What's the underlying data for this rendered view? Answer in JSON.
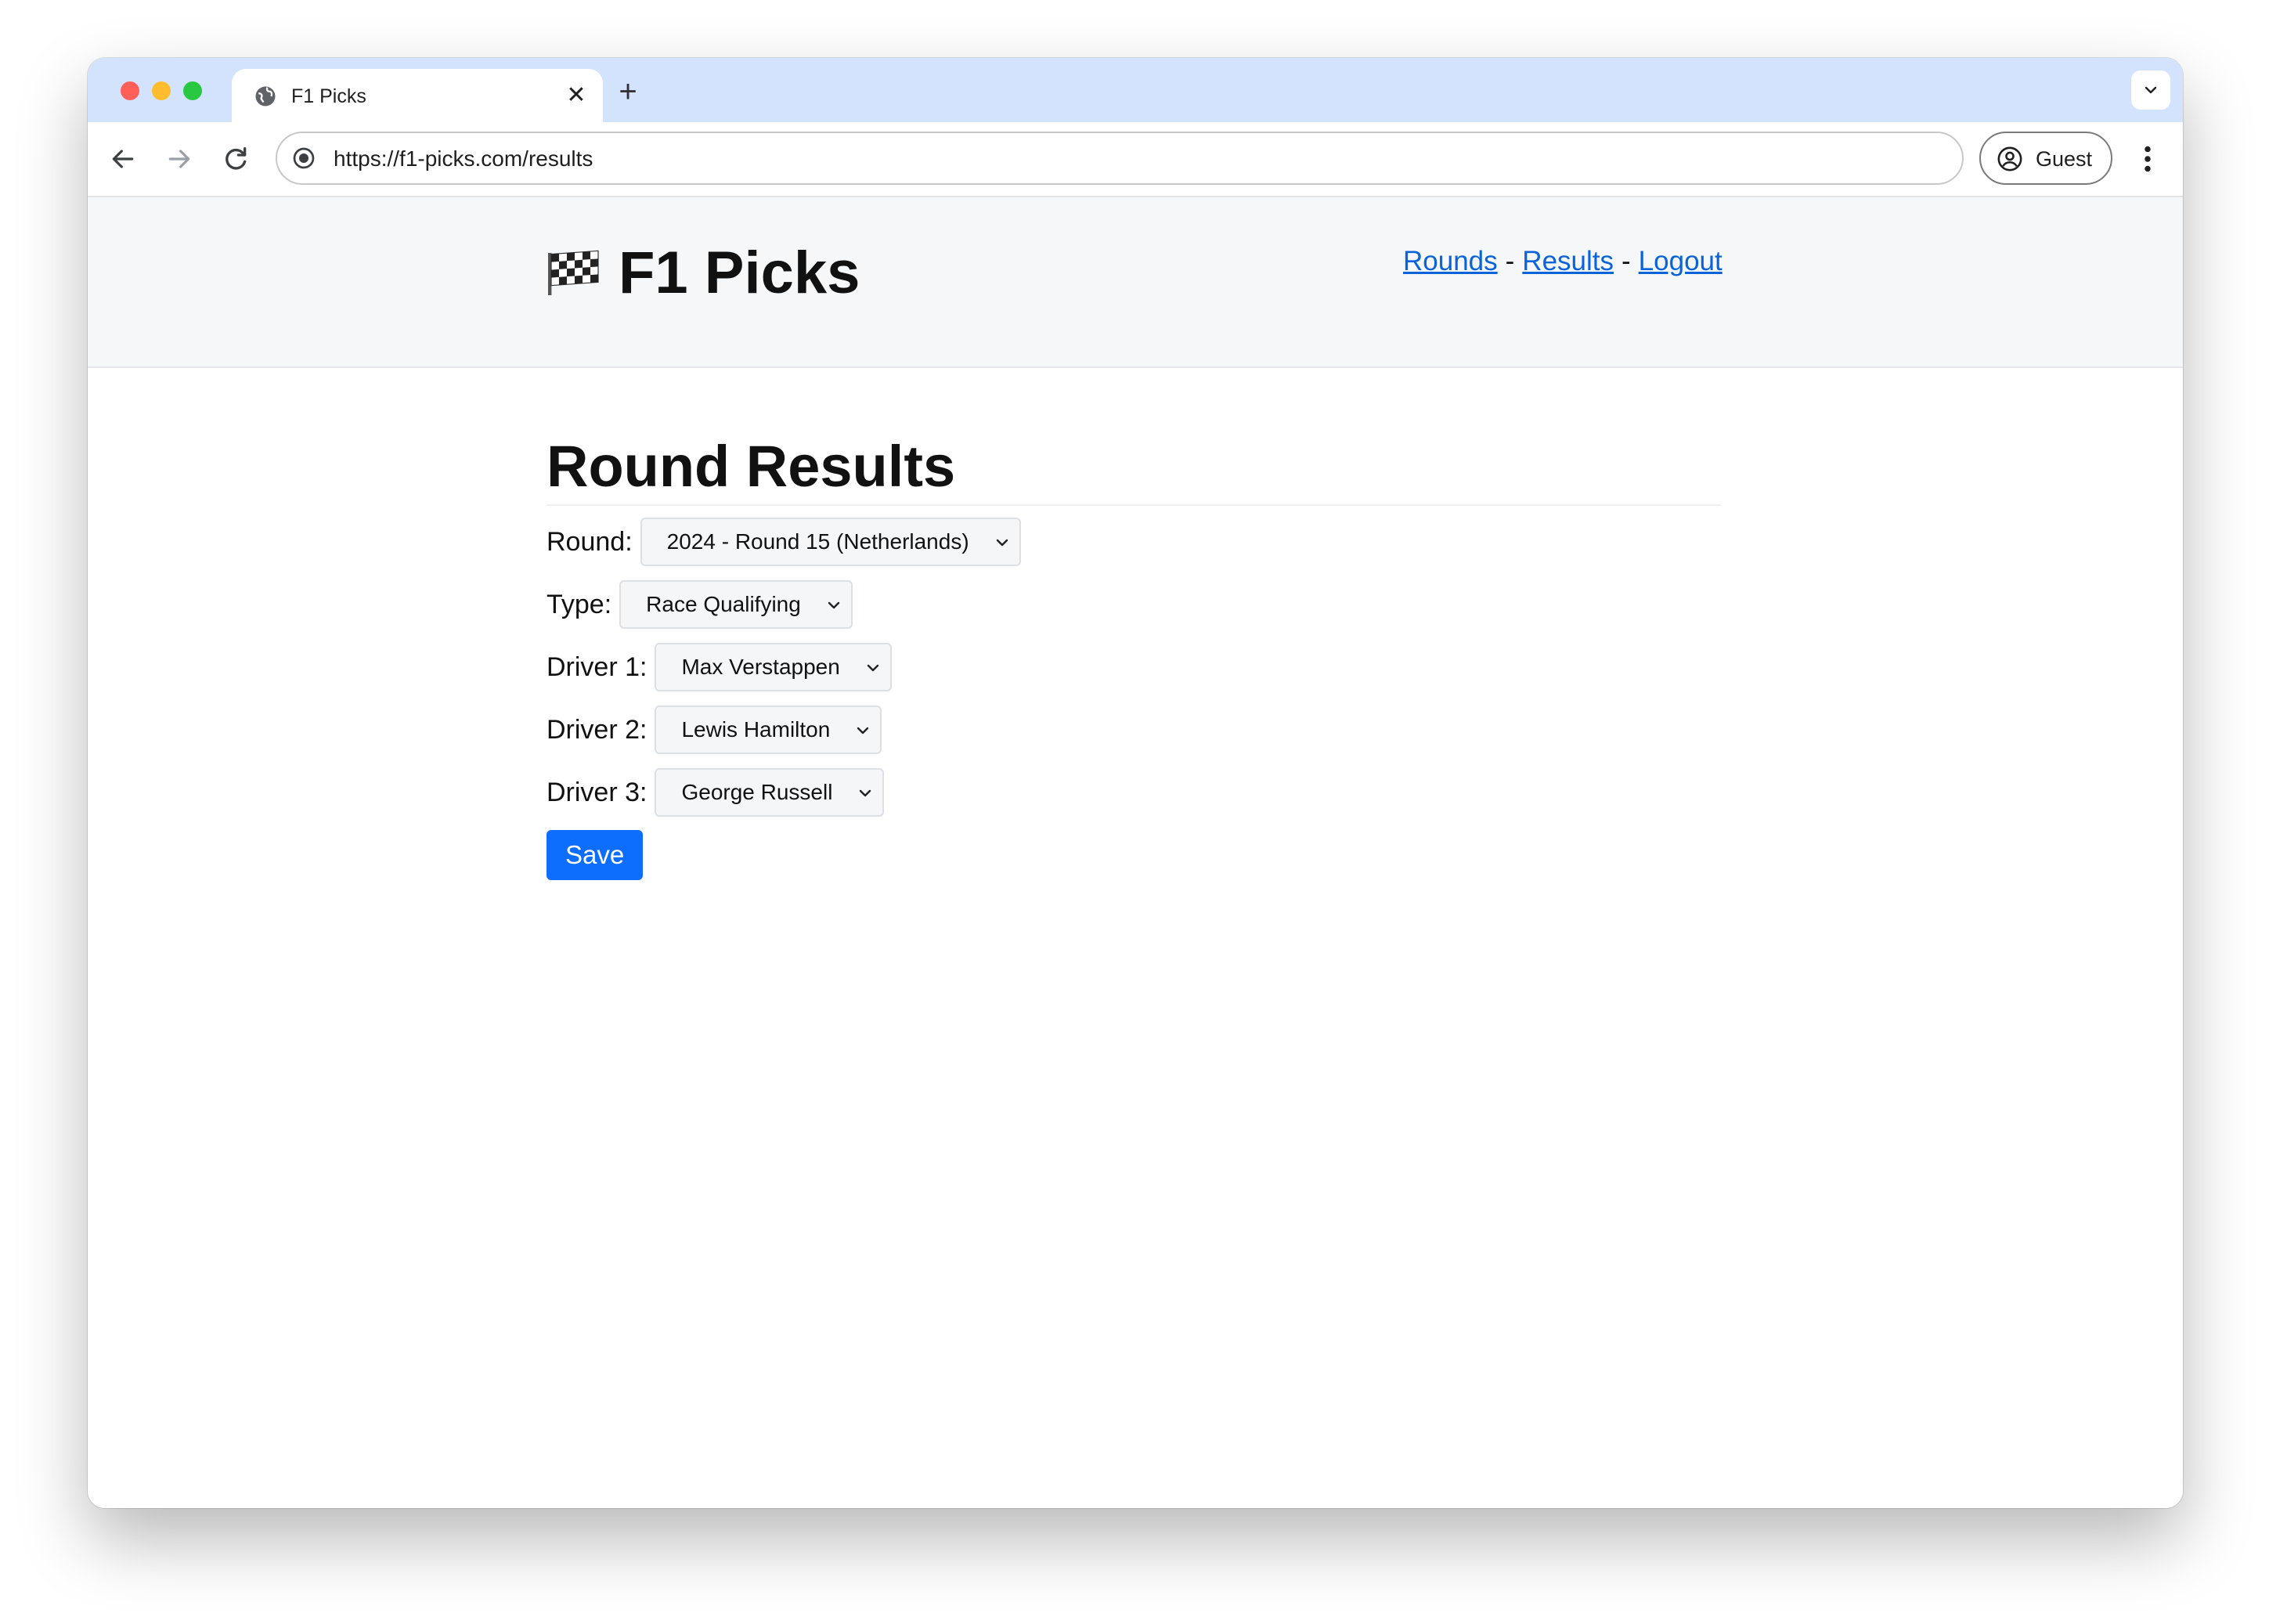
{
  "browser": {
    "tab_title": "F1 Picks",
    "url": "https://f1-picks.com/results",
    "profile_label": "Guest",
    "icons": {
      "tab_favicon": "globe-icon",
      "close": "close-icon",
      "new_tab": "plus-icon",
      "tab_search": "chevron-down-icon",
      "back": "arrow-left-icon",
      "forward": "arrow-right-icon",
      "reload": "reload-icon",
      "site_info": "site-info-icon",
      "profile": "person-circle-icon",
      "menu": "kebab-menu-icon"
    },
    "colors": {
      "tabstrip": "#d3e3fd",
      "traffic_red": "#ff5f57",
      "traffic_yellow": "#febc2e",
      "traffic_green": "#28c840"
    }
  },
  "header": {
    "title": "F1 Picks",
    "logo_icon": "chequered-flag-icon",
    "nav": {
      "rounds": "Rounds",
      "results": "Results",
      "logout": "Logout",
      "separator": "-"
    },
    "colors": {
      "background": "#f6f7f9",
      "link": "#0a63d8"
    }
  },
  "main": {
    "heading": "Round Results",
    "form": {
      "round": {
        "label": "Round:",
        "value": "2024 - Round 15 (Netherlands)"
      },
      "type": {
        "label": "Type:",
        "value": "Race Qualifying"
      },
      "driver1": {
        "label": "Driver 1:",
        "value": "Max Verstappen"
      },
      "driver2": {
        "label": "Driver 2:",
        "value": "Lewis Hamilton"
      },
      "driver3": {
        "label": "Driver 3:",
        "value": "George Russell"
      },
      "save_label": "Save"
    },
    "colors": {
      "primary": "#0d6efd"
    }
  }
}
